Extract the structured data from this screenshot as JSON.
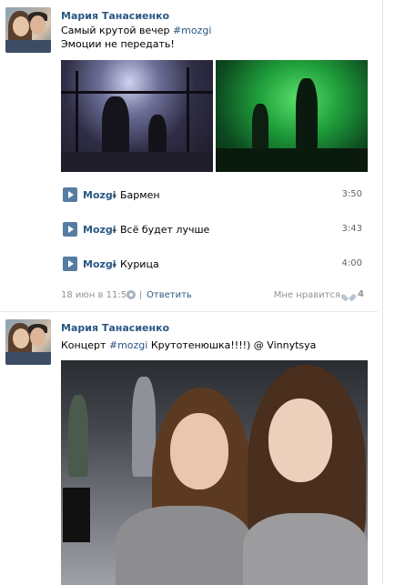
{
  "posts": [
    {
      "author": "Мария Танасиенко",
      "text_line1_prefix": "Самый крутой вечер ",
      "hashtag": "#mozgi",
      "text_line2": "Эмоции не передать!",
      "tracks": [
        {
          "artist": "Mozgi",
          "dash": " – ",
          "title": "Бармен",
          "duration": "3:50"
        },
        {
          "artist": "Mozgi",
          "dash": " – ",
          "title": "Всё будет лучше",
          "duration": "3:43"
        },
        {
          "artist": "Mozgi",
          "dash": " – ",
          "title": "Курица",
          "duration": "4:00"
        }
      ],
      "date": "18 июн в 11:55",
      "separator": "|",
      "reply": "Ответить",
      "like_label": "Мне нравится",
      "likes": "4"
    },
    {
      "author": "Мария Танасиенко",
      "text_prefix": "Концерт ",
      "hashtag": "#mozgi",
      "text_suffix": " Крутотенюшка!!!!) @ Vinnytsya"
    }
  ],
  "icons": {
    "play": "play-icon",
    "gear": "gear-icon",
    "heart": "heart-icon"
  },
  "colors": {
    "link": "#2a5885",
    "play_button": "#577ca1",
    "meta": "#939393",
    "divider": "#e7e8ec"
  }
}
